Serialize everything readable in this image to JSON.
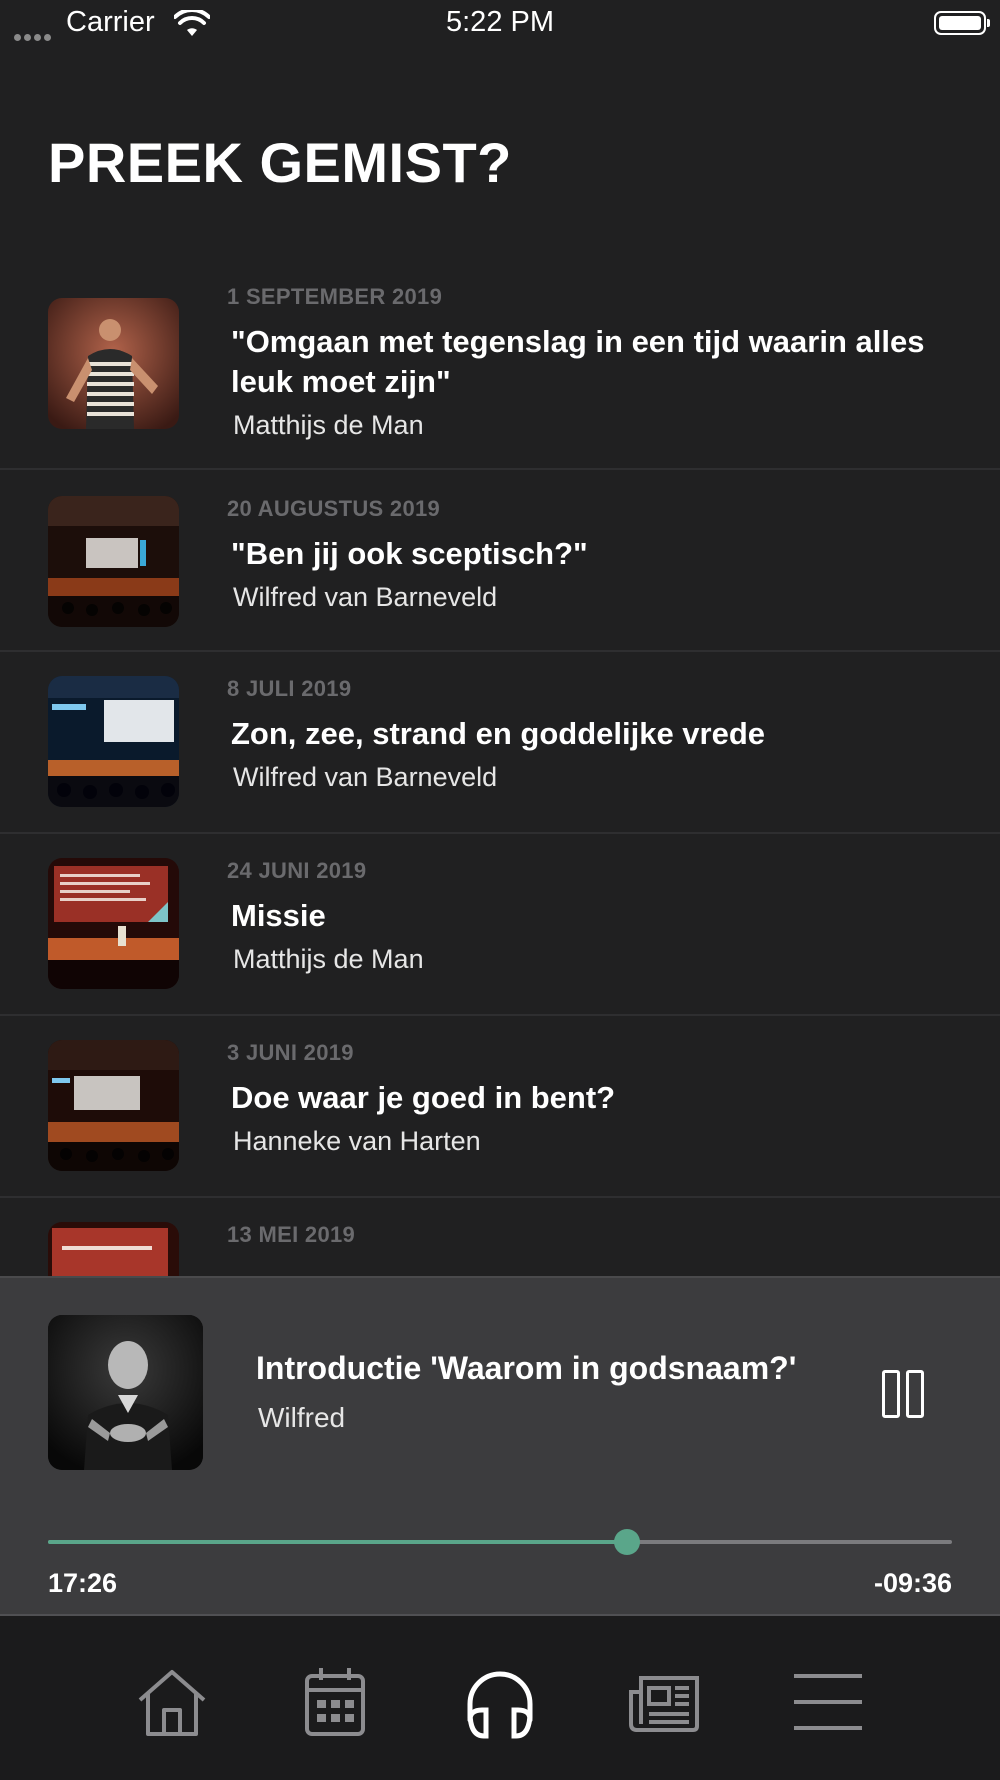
{
  "status_bar": {
    "carrier": "Carrier",
    "time": "5:22 PM"
  },
  "page": {
    "title": "PREEK GEMIST?"
  },
  "sermons": [
    {
      "date": "1 SEPTEMBER 2019",
      "title": "\"Omgaan met tegenslag in een tijd waarin alles leuk moet zijn\"",
      "speaker": "Matthijs de Man"
    },
    {
      "date": "20 AUGUSTUS 2019",
      "title": "\"Ben jij ook sceptisch?\"",
      "speaker": "Wilfred van Barneveld"
    },
    {
      "date": "8 JULI 2019",
      "title": "Zon, zee, strand en goddelijke vrede",
      "speaker": "Wilfred van Barneveld"
    },
    {
      "date": "24 JUNI 2019",
      "title": "Missie",
      "speaker": "Matthijs de Man"
    },
    {
      "date": "3 JUNI 2019",
      "title": "Doe waar je goed in bent?",
      "speaker": "Hanneke van Harten"
    },
    {
      "date": "13 MEI 2019",
      "title": "",
      "speaker": ""
    }
  ],
  "player": {
    "title": "Introductie 'Waarom in godsnaam?'",
    "speaker": "Wilfred",
    "elapsed": "17:26",
    "remaining": "-09:36",
    "progress": 0.64,
    "accent_color": "#5aa68a"
  },
  "tab_bar": {
    "tabs": [
      {
        "icon": "home-icon",
        "active": false
      },
      {
        "icon": "calendar-icon",
        "active": false
      },
      {
        "icon": "headphones-icon",
        "active": true
      },
      {
        "icon": "newspaper-icon",
        "active": false
      },
      {
        "icon": "menu-icon",
        "active": false
      }
    ]
  }
}
